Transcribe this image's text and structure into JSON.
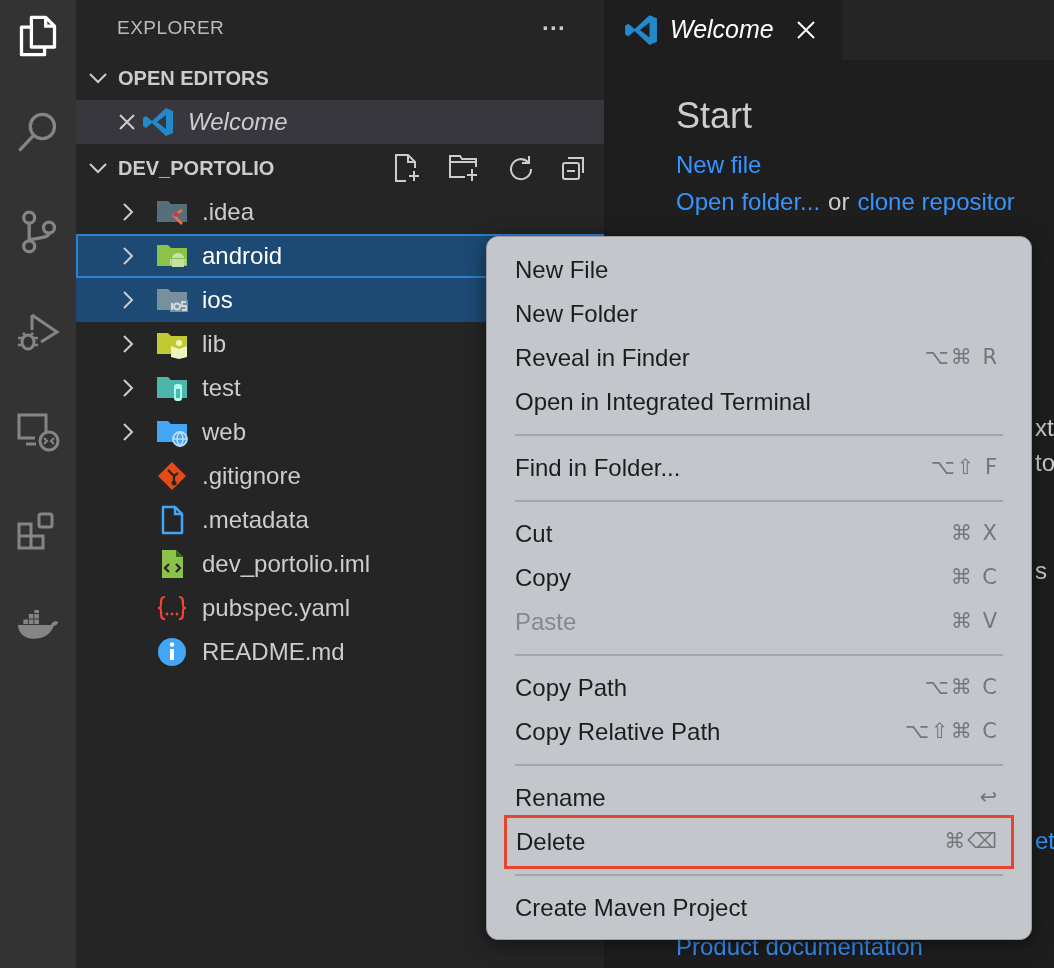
{
  "activity_bar": {
    "items": [
      {
        "kind": "explorer",
        "selected": true
      },
      {
        "kind": "search",
        "selected": false
      },
      {
        "kind": "source-control",
        "selected": false
      },
      {
        "kind": "run-debug",
        "selected": false
      },
      {
        "kind": "remote",
        "selected": false
      },
      {
        "kind": "extensions",
        "selected": false
      },
      {
        "kind": "docker",
        "selected": false
      }
    ]
  },
  "sidebar": {
    "title": "EXPLORER",
    "more": "···",
    "open_editors": {
      "label": "OPEN EDITORS",
      "expanded": true,
      "items": [
        {
          "name": "Welcome",
          "selected": true
        }
      ]
    },
    "folder": {
      "label": "DEV_PORTOLIO",
      "expanded": true,
      "items": [
        {
          "name": ".idea",
          "kind": "idea",
          "selected": false,
          "focused": false
        },
        {
          "name": "android",
          "kind": "android",
          "selected": true,
          "focused": true
        },
        {
          "name": "ios",
          "kind": "ios",
          "selected": true,
          "focused": false
        },
        {
          "name": "lib",
          "kind": "lib",
          "selected": false,
          "focused": false
        },
        {
          "name": "test",
          "kind": "test",
          "selected": false,
          "focused": false
        },
        {
          "name": "web",
          "kind": "web",
          "selected": false,
          "focused": false
        },
        {
          "name": ".gitignore",
          "kind": "git",
          "selected": false,
          "focused": false
        },
        {
          "name": ".metadata",
          "kind": "file",
          "selected": false,
          "focused": false
        },
        {
          "name": "dev_portolio.iml",
          "kind": "xml",
          "selected": false,
          "focused": false
        },
        {
          "name": "pubspec.yaml",
          "kind": "yaml",
          "selected": false,
          "focused": false
        },
        {
          "name": "README.md",
          "kind": "info",
          "selected": false,
          "focused": false
        }
      ]
    }
  },
  "editor": {
    "tabs": [
      {
        "title": "Welcome",
        "selected": true
      }
    ],
    "heading": "Start",
    "links": [
      {
        "parts": [
          {
            "text": "New file",
            "link": true
          }
        ]
      },
      {
        "parts": [
          {
            "text": "Open folder...",
            "link": true
          },
          {
            "text": "or",
            "link": false
          },
          {
            "text": "clone repositor",
            "link": true
          }
        ]
      }
    ],
    "cut_texts": [
      {
        "text": "xt",
        "link": false
      },
      {
        "text": "to",
        "link": false
      },
      {
        "text": "s",
        "link": false
      },
      {
        "text": "et",
        "link": true
      }
    ],
    "bottom_link": "Product documentation"
  },
  "context_menu": {
    "items": [
      {
        "kind": "item",
        "label": "New File",
        "disabled": false,
        "marked": false
      },
      {
        "kind": "item",
        "label": "New Folder",
        "disabled": false,
        "marked": false
      },
      {
        "kind": "item",
        "label": "Reveal in Finder",
        "shortcut": "⌥⌘ R",
        "disabled": false,
        "marked": false
      },
      {
        "kind": "item",
        "label": "Open in Integrated Terminal",
        "disabled": false,
        "marked": false
      },
      {
        "kind": "separator"
      },
      {
        "kind": "item",
        "label": "Find in Folder...",
        "shortcut": "⌥⇧ F",
        "disabled": false,
        "marked": false
      },
      {
        "kind": "separator"
      },
      {
        "kind": "item",
        "label": "Cut",
        "shortcut": "⌘ X",
        "disabled": false,
        "marked": false
      },
      {
        "kind": "item",
        "label": "Copy",
        "shortcut": "⌘ C",
        "disabled": false,
        "marked": false
      },
      {
        "kind": "item",
        "label": "Paste",
        "shortcut": "⌘ V",
        "disabled": true,
        "marked": false
      },
      {
        "kind": "separator"
      },
      {
        "kind": "item",
        "label": "Copy Path",
        "shortcut": "⌥⌘ C",
        "disabled": false,
        "marked": false
      },
      {
        "kind": "item",
        "label": "Copy Relative Path",
        "shortcut": "⌥⇧⌘ C",
        "disabled": false,
        "marked": false
      },
      {
        "kind": "separator"
      },
      {
        "kind": "item",
        "label": "Rename",
        "shortcut": "↩",
        "disabled": false,
        "marked": false
      },
      {
        "kind": "item",
        "label": "Delete",
        "shortcut": "⌘⌫",
        "disabled": false,
        "marked": true
      },
      {
        "kind": "separator"
      },
      {
        "kind": "item",
        "label": "Create Maven Project",
        "disabled": false,
        "marked": false
      }
    ]
  }
}
